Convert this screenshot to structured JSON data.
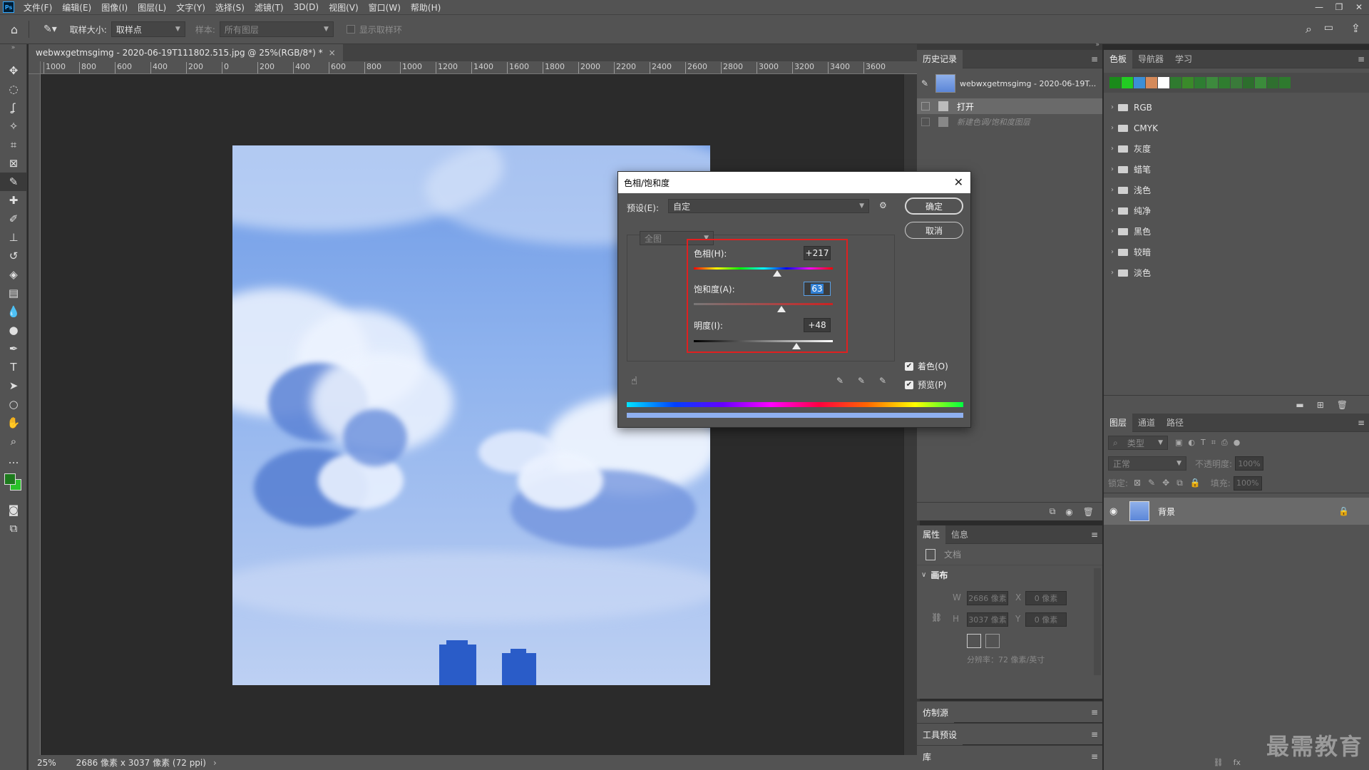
{
  "app": {
    "logo": "Ps",
    "menus": [
      "文件(F)",
      "编辑(E)",
      "图像(I)",
      "图层(L)",
      "文字(Y)",
      "选择(S)",
      "滤镜(T)",
      "3D(D)",
      "视图(V)",
      "窗口(W)",
      "帮助(H)"
    ]
  },
  "options": {
    "sample_size_label": "取样大小:",
    "sample_size_value": "取样点",
    "sample_label": "样本:",
    "sample_value": "所有图层",
    "show_ring_label": "显示取样环"
  },
  "document": {
    "tab_title": "webwxgetmsgimg - 2020-06-19T111802.515.jpg @ 25%(RGB/8*) *",
    "ruler_ticks": [
      "1000",
      "800",
      "600",
      "400",
      "200",
      "0",
      "200",
      "400",
      "600",
      "800",
      "1000",
      "1200",
      "1400",
      "1600",
      "1800",
      "2000",
      "2200",
      "2400",
      "2600",
      "2800",
      "3000",
      "3200",
      "3400",
      "3600"
    ],
    "zoom": "25%",
    "size_info": "2686 像素 x 3037 像素 (72 ppi)"
  },
  "history": {
    "tab": "历史记录",
    "snapshot_label": "webwxgetmsgimg - 2020-06-19T...",
    "items": [
      "打开",
      "新建色调/饱和度图层"
    ]
  },
  "properties": {
    "tabs": [
      "属性",
      "信息"
    ],
    "doc_label": "文档",
    "section": "画布",
    "w_label": "W",
    "w_value": "2686 像素",
    "h_label": "H",
    "h_value": "3037 像素",
    "x_label": "X",
    "x_value": "0 像素",
    "y_label": "Y",
    "y_value": "0 像素",
    "resolution": "分辨率：72 像素/英寸"
  },
  "collapsed_panels": [
    "仿制源",
    "工具预设",
    "库"
  ],
  "swatches": {
    "tabs": [
      "色板",
      "导航器",
      "学习"
    ],
    "recent_colors": [
      "#1a8a1a",
      "#22cc22",
      "#3b8fd6",
      "#d58a5a",
      "#ffffff",
      "#2f7a2f",
      "#3a8a2a",
      "#2e7d32",
      "#3d8a3d",
      "#2f7d2f",
      "#3a7a3a",
      "#2d6e2d",
      "#3b8b3b",
      "#2f6f2f",
      "#2e7a2e"
    ],
    "groups": [
      "RGB",
      "CMYK",
      "灰度",
      "蜡笔",
      "浅色",
      "纯净",
      "黑色",
      "较暗",
      "淡色"
    ]
  },
  "layers": {
    "tabs": [
      "图层",
      "通道",
      "路径"
    ],
    "filter_label": "类型",
    "blend_mode": "正常",
    "opacity_label": "不透明度:",
    "opacity_value": "100%",
    "lock_label": "锁定:",
    "fill_label": "填充:",
    "fill_value": "100%",
    "layer_name": "背景"
  },
  "dialog": {
    "title": "色相/饱和度",
    "preset_label": "预设(E):",
    "preset_value": "自定",
    "ok_label": "确定",
    "cancel_label": "取消",
    "channel_value": "全图",
    "hue_label": "色相(H):",
    "hue_value": "+217",
    "hue_level": 0.6,
    "sat_label": "饱和度(A):",
    "sat_value": "63",
    "sat_level": 0.63,
    "light_label": "明度(I):",
    "light_value": "+48",
    "light_level": 0.74,
    "colorize_label": "着色(O)",
    "preview_label": "预览(P)",
    "highlight_color": "#e02020"
  },
  "watermark": "最需教育"
}
